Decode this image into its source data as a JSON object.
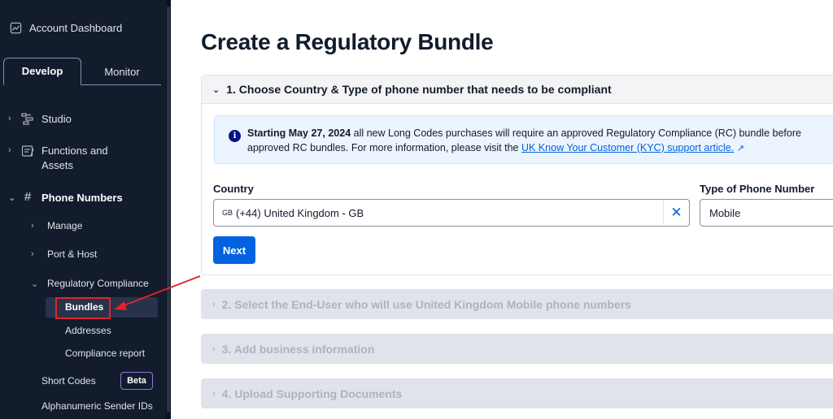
{
  "sidebar": {
    "account_label": "Account Dashboard",
    "tabs": [
      {
        "label": "Develop",
        "active": true
      },
      {
        "label": "Monitor",
        "active": false
      }
    ],
    "items": [
      {
        "label": "Studio"
      },
      {
        "label": "Functions and Assets"
      },
      {
        "label": "Phone Numbers"
      }
    ],
    "functions_line1": "Functions and",
    "functions_line2": "Assets",
    "sub_items": [
      {
        "label": "Manage"
      },
      {
        "label": "Port & Host"
      },
      {
        "label": "Regulatory Compliance"
      }
    ],
    "compliance_items": [
      {
        "label": "Bundles"
      },
      {
        "label": "Addresses"
      },
      {
        "label": "Compliance report"
      }
    ],
    "short_codes": "Short Codes",
    "beta_badge": "Beta",
    "alphanumeric": "Alphanumeric Sender IDs"
  },
  "main": {
    "title": "Create a Regulatory Bundle",
    "step1": {
      "header": "1. Choose Country & Type of phone number that needs to be compliant",
      "info_bold": "Starting May 27, 2024",
      "info_text_1": " all new Long Codes purchases will require an approved Regulatory Compliance (RC) bundle before",
      "info_text_2": "approved RC bundles. For more information, please visit the ",
      "info_link": "UK Know Your Customer (KYC) support article.",
      "country_label": "Country",
      "country_code": "GB",
      "country_value": "(+44) United Kingdom - GB",
      "type_label": "Type of Phone Number",
      "type_value": "Mobile",
      "next_label": "Next"
    },
    "steps": [
      {
        "label": "2. Select the End-User who will use United Kingdom Mobile phone numbers"
      },
      {
        "label": "3. Add business information"
      },
      {
        "label": "4. Upload Supporting Documents"
      }
    ]
  },
  "colors": {
    "sidebar_bg": "#121c2d",
    "primary": "#0263e0",
    "highlight": "#e3232b"
  }
}
